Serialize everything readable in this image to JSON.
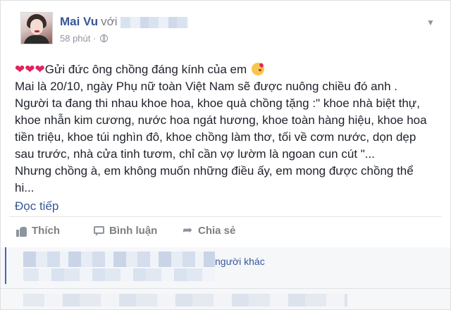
{
  "post": {
    "author": "Mai Vu",
    "with_label": "với",
    "time": "58 phút",
    "time_separator": "·",
    "privacy_icon": "globe-icon",
    "menu_icon": "chevron-down-icon",
    "hearts": "❤❤❤",
    "line1": "Gửi đức ông chồng đáng kính của em",
    "line2": "Mai là 20/10, ngày Phụ nữ toàn Việt Nam sẽ được nuông chiều đó anh .",
    "line3": "Người ta đang thi nhau khoe hoa, khoe quà chồng tặng :\" khoe nhà biệt thự,",
    "line4": "khoe nhẫn kim cương, nước hoa ngát hương, khoe toàn hàng hiệu, khoe hoa",
    "line5": "tiền triệu, khoe túi nghìn đô, khoe chồng làm thơ, tối về cơm nước, dọn dẹp",
    "line6": "sau trước, nhà cửa tinh tươm, chỉ cần vợ lườm là ngoan cun cút \"...",
    "line7": "Nhưng chồng à, em không muốn những điều ấy, em mong được chồng thể",
    "line8": "hi...",
    "read_more": "Đọc tiếp"
  },
  "actions": {
    "like": "Thích",
    "comment": "Bình luận",
    "share": "Chia sẻ"
  },
  "footer": {
    "others": "người khác"
  },
  "colors": {
    "link": "#365899",
    "text": "#1d2129",
    "muted": "#90949c",
    "heart": "#e0245e"
  }
}
